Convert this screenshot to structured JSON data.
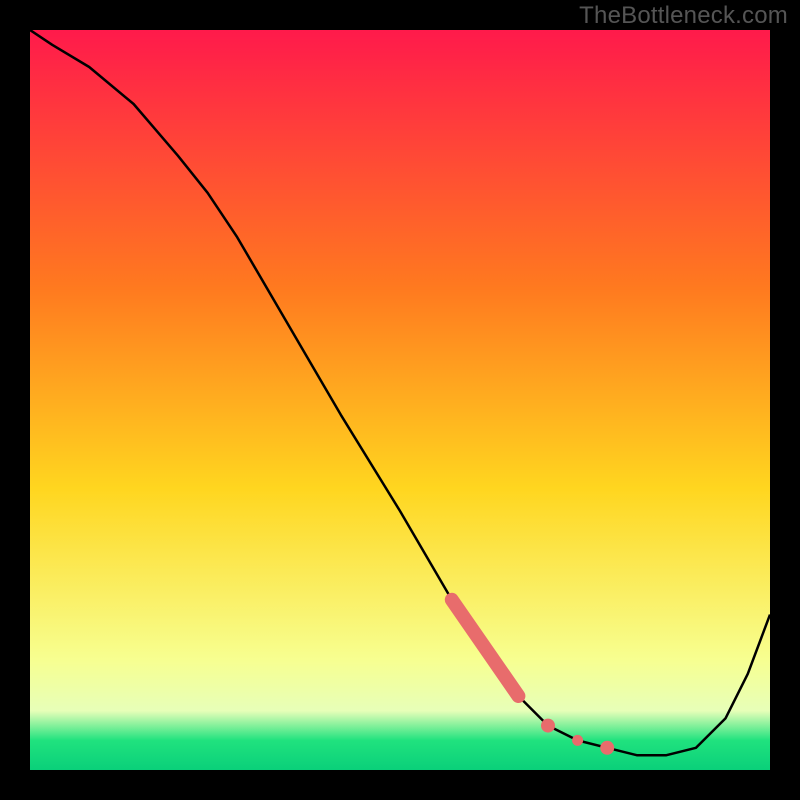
{
  "watermark": "TheBottleneck.com",
  "colors": {
    "frame": "#000000",
    "gradient_top": "#ff1a4b",
    "gradient_mid1": "#ff7a1f",
    "gradient_mid2": "#ffd61f",
    "gradient_low": "#f7ff90",
    "gradient_band_pale": "#e7ffb8",
    "gradient_band_green": "#20e27e",
    "gradient_bottom": "#0ad07a",
    "curve": "#000000",
    "marker": "#e86c6c"
  },
  "chart_data": {
    "type": "line",
    "title": "",
    "xlabel": "",
    "ylabel": "",
    "xlim": [
      0,
      100
    ],
    "ylim": [
      0,
      100
    ],
    "series": [
      {
        "name": "bottleneck-curve",
        "x": [
          0,
          3,
          8,
          14,
          20,
          24,
          28,
          35,
          42,
          50,
          57,
          62,
          66,
          70,
          74,
          78,
          82,
          86,
          90,
          94,
          97,
          100
        ],
        "y": [
          100,
          98,
          95,
          90,
          83,
          78,
          72,
          60,
          48,
          35,
          23,
          15,
          10,
          6,
          4,
          3,
          2,
          2,
          3,
          7,
          13,
          21
        ]
      }
    ],
    "markers": [
      {
        "name": "highlight-segment",
        "shape": "thick-line",
        "x": [
          57,
          66
        ],
        "y": [
          23,
          10
        ]
      },
      {
        "name": "dot-1",
        "shape": "circle",
        "x": 70,
        "y": 6
      },
      {
        "name": "dot-2",
        "shape": "circle",
        "x": 74,
        "y": 4
      },
      {
        "name": "dot-3",
        "shape": "circle",
        "x": 78,
        "y": 3
      }
    ]
  }
}
